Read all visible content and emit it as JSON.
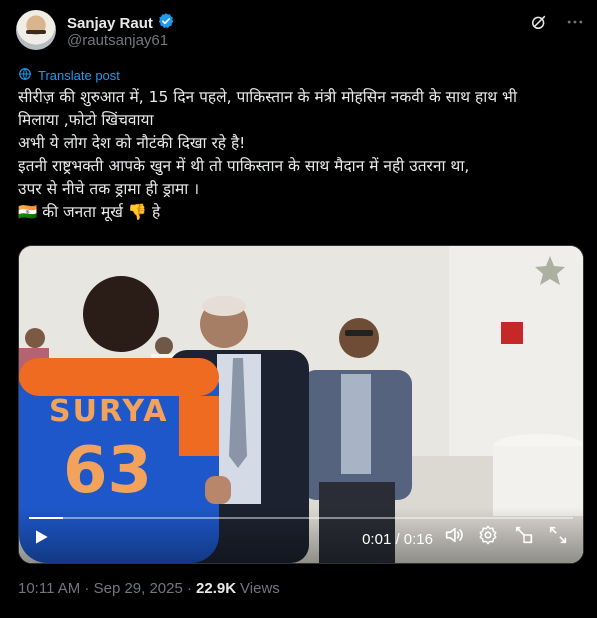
{
  "author": {
    "name": "Sanjay Raut",
    "handle": "@rautsanjay61",
    "verified": true
  },
  "header_icons": [
    "grok-icon",
    "more-icon"
  ],
  "translate": {
    "label": "Translate post",
    "icon": "globe-icon"
  },
  "post_lines": [
    "सीरीज़ की शुरुआत में, 15 दिन पहले, पाकिस्तान के मंत्री मोहसिन नकवी के साथ हाथ भी",
    "मिलाया ,फोटो खिंचवाया",
    "अभी ये लोग देश को नौटंकी दिखा रहे है!",
    "इतनी राष्ट्रभक्ती आपके खुन में थी तो पाकिस्तान के साथ मैदान में नही उतरना था,",
    "उपर से नीचे तक ड्रामा ही ड्रामा ।",
    "🇮🇳 की जनता मूर्ख 👎 हे"
  ],
  "video": {
    "jersey_name": "SURYA",
    "jersey_number": "63",
    "time": "0:01 / 0:16",
    "progress_fraction": 0.0625,
    "icons": [
      "play-icon",
      "volume-icon",
      "settings-icon",
      "pip-icon",
      "fullscreen-icon"
    ]
  },
  "footer": {
    "time": "10:11 AM · Sep 29, 2025 ·",
    "views_count": "22.9K",
    "views_label": "Views"
  },
  "colors": {
    "accent": "#1d9bf0",
    "background": "#000000",
    "secondary_text": "#71767b"
  }
}
